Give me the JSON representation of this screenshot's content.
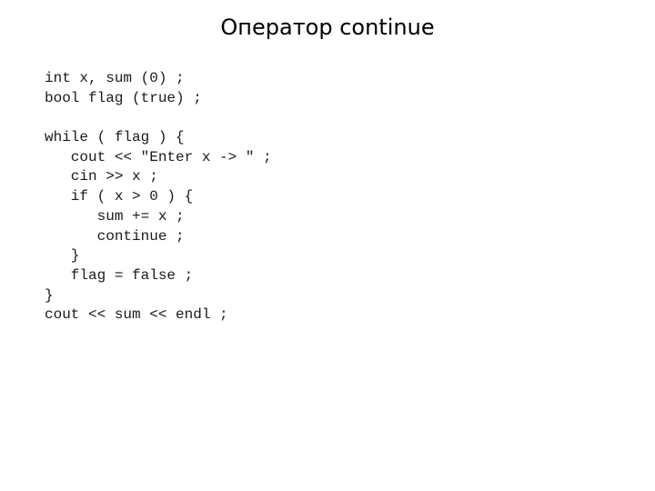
{
  "slide": {
    "title_prefix": "Оператор ",
    "title_keyword": "continue"
  },
  "code": {
    "lines": [
      "int x, sum (0) ;",
      "bool flag (true) ;",
      "",
      "while ( flag ) {",
      "   cout << \"Enter x -> \" ;",
      "   cin >> x ;",
      "   if ( x > 0 ) {",
      "      sum += x ;",
      "      continue ;",
      "   }",
      "   flag = false ;",
      "}",
      "cout << sum << endl ;"
    ]
  }
}
